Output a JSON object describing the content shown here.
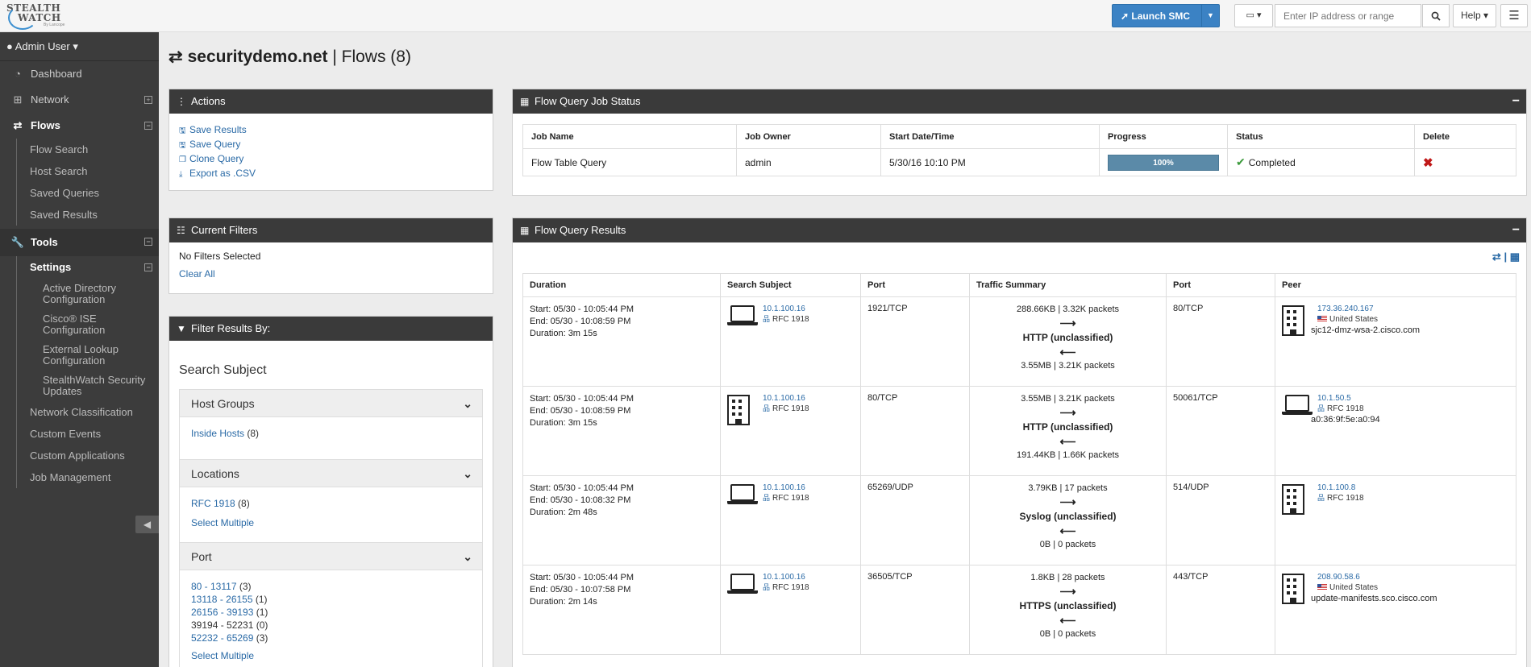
{
  "app": {
    "logo_line1": "STEALTH",
    "logo_line2": "WATCH",
    "logo_byline": "By Lancope"
  },
  "topbar": {
    "launch_label": "Launch SMC",
    "ip_placeholder": "Enter IP address or range",
    "help_label": "Help"
  },
  "sidebar": {
    "user": "Admin User",
    "dashboard": "Dashboard",
    "network": "Network",
    "flows": "Flows",
    "flows_sub": [
      "Flow Search",
      "Host Search",
      "Saved Queries",
      "Saved Results"
    ],
    "tools": "Tools",
    "settings": "Settings",
    "settings_sub": [
      "Active Directory Configuration",
      "Cisco® ISE Configuration",
      "External Lookup Configuration",
      "StealthWatch Security Updates"
    ],
    "tools_sub": [
      "Network Classification",
      "Custom Events",
      "Custom Applications",
      "Job Management"
    ]
  },
  "page": {
    "title_bold": "securitydemo.net",
    "title_rest": " | Flows (8)"
  },
  "actions": {
    "title": "Actions",
    "items": [
      "Save Results",
      "Save Query",
      "Clone Query",
      "Export as .CSV"
    ]
  },
  "current_filters": {
    "title": "Current Filters",
    "none_text": "No Filters Selected",
    "clear_all": "Clear All"
  },
  "filter_by": {
    "title": "Filter Results By:",
    "subject_title": "Search Subject",
    "host_groups": {
      "title": "Host Groups",
      "items": [
        {
          "label": "Inside Hosts",
          "count": "(8)"
        }
      ]
    },
    "locations": {
      "title": "Locations",
      "items": [
        {
          "label": "RFC 1918",
          "count": "(8)"
        }
      ],
      "select_multiple": "Select Multiple"
    },
    "port": {
      "title": "Port",
      "items": [
        {
          "label": "80 - 13117",
          "count": "(3)"
        },
        {
          "label": "13118 - 26155",
          "count": "(1)"
        },
        {
          "label": "26156 - 39193",
          "count": "(1)"
        },
        {
          "label": "39194 - 52231",
          "count": "(0)"
        },
        {
          "label": "52232 - 65269",
          "count": "(3)"
        }
      ],
      "select_multiple": "Select Multiple"
    }
  },
  "job_status": {
    "title": "Flow Query Job Status",
    "headers": [
      "Job Name",
      "Job Owner",
      "Start Date/Time",
      "Progress",
      "Status",
      "Delete"
    ],
    "row": {
      "name": "Flow Table Query",
      "owner": "admin",
      "start": "5/30/16 10:10 PM",
      "progress_label": "100%",
      "progress_value": 100,
      "status": "Completed"
    }
  },
  "results": {
    "title": "Flow Query Results",
    "headers": [
      "Duration",
      "Search Subject",
      "Port",
      "Traffic Summary",
      "Port",
      "Peer"
    ],
    "rows": [
      {
        "start": "Start: 05/30 - 10:05:44 PM",
        "end": "End: 05/30 - 10:08:59 PM",
        "duration": "Duration: 3m 15s",
        "subject_ip": "10.1.100.16",
        "subject_loc": "RFC 1918",
        "subject_type": "laptop",
        "port": "1921/TCP",
        "traffic_out": "288.66KB | 3.32K packets",
        "protocol": "HTTP (unclassified)",
        "traffic_in": "3.55MB | 3.21K packets",
        "peer_port": "80/TCP",
        "peer_ip": "173.36.240.167",
        "peer_loc": "United States",
        "peer_host": "sjc12-dmz-wsa-2.cisco.com",
        "peer_type": "building"
      },
      {
        "start": "Start: 05/30 - 10:05:44 PM",
        "end": "End: 05/30 - 10:08:59 PM",
        "duration": "Duration: 3m 15s",
        "subject_ip": "10.1.100.16",
        "subject_loc": "RFC 1918",
        "subject_type": "building",
        "port": "80/TCP",
        "traffic_out": "3.55MB | 3.21K packets",
        "protocol": "HTTP (unclassified)",
        "traffic_in": "191.44KB | 1.66K packets",
        "peer_port": "50061/TCP",
        "peer_ip": "10.1.50.5",
        "peer_loc": "RFC 1918",
        "peer_host": "a0:36:9f:5e:a0:94",
        "peer_type": "laptop"
      },
      {
        "start": "Start: 05/30 - 10:05:44 PM",
        "end": "End: 05/30 - 10:08:32 PM",
        "duration": "Duration: 2m 48s",
        "subject_ip": "10.1.100.16",
        "subject_loc": "RFC 1918",
        "subject_type": "laptop",
        "port": "65269/UDP",
        "traffic_out": "3.79KB | 17 packets",
        "protocol": "Syslog (unclassified)",
        "traffic_in": "0B | 0 packets",
        "peer_port": "514/UDP",
        "peer_ip": "10.1.100.8",
        "peer_loc": "RFC 1918",
        "peer_host": "",
        "peer_type": "building"
      },
      {
        "start": "Start: 05/30 - 10:05:44 PM",
        "end": "End: 05/30 - 10:07:58 PM",
        "duration": "Duration: 2m 14s",
        "subject_ip": "10.1.100.16",
        "subject_loc": "RFC 1918",
        "subject_type": "laptop",
        "port": "36505/TCP",
        "traffic_out": "1.8KB | 28 packets",
        "protocol": "HTTPS (unclassified)",
        "traffic_in": "0B | 0 packets",
        "peer_port": "443/TCP",
        "peer_ip": "208.90.58.6",
        "peer_loc": "United States",
        "peer_host": "update-manifests.sco.cisco.com",
        "peer_type": "building"
      }
    ]
  }
}
